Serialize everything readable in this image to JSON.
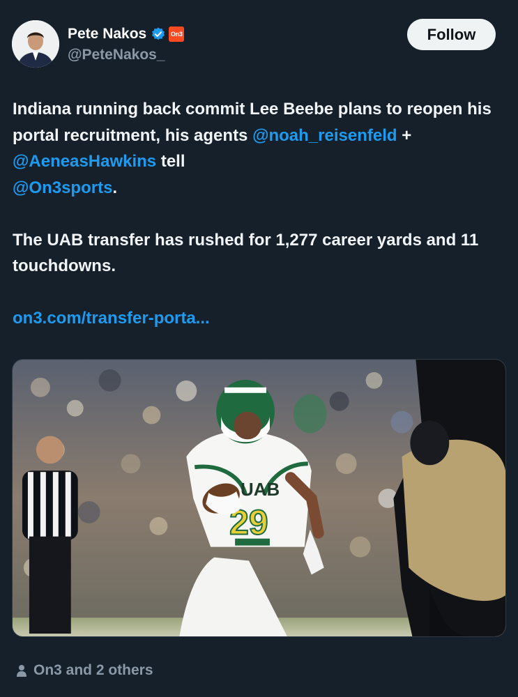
{
  "author": {
    "display_name": "Pete Nakos",
    "handle": "@PeteNakos_",
    "org_badge": "On3",
    "verified_color": "#1d9bf0",
    "org_badge_color": "#ff4a22"
  },
  "follow_label": "Follow",
  "tweet": {
    "line1_text": "Indiana running back commit Lee Beebe plans to reopen his portal recruitment, his agents ",
    "mention1": "@noah_reisenfeld",
    "plus": " + ",
    "mention2": "@AeneasHawkins",
    "tell": " tell ",
    "mention3": "@On3sports",
    "period": ".",
    "para2": "The UAB transfer has rushed for 1,277 career yards and 11 touchdowns.",
    "link": "on3.com/transfer-porta..."
  },
  "media": {
    "jersey_text": "UAB",
    "jersey_number": "29",
    "accent_green": "#1f6b3f"
  },
  "footer": {
    "icon": "person-icon",
    "text": "On3 and 2 others"
  },
  "colors": {
    "background": "#16202b",
    "link": "#1d9bf0",
    "muted": "#8b98a5"
  }
}
